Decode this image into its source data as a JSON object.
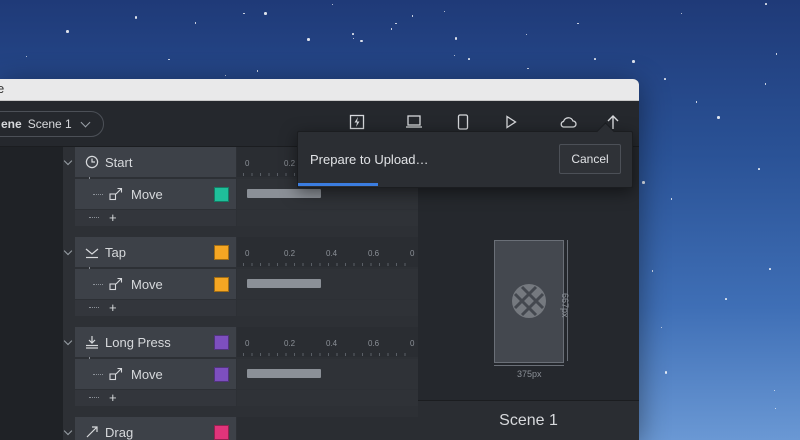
{
  "window": {
    "title_fragment": "e"
  },
  "toolbar": {
    "scene_label": "ene",
    "scene_value": "Scene 1",
    "icons": [
      "flash-icon",
      "laptop-icon",
      "phone-icon",
      "play-icon",
      "cloud-icon",
      "upload-arrow-icon"
    ]
  },
  "groups": [
    {
      "trigger": "Start",
      "trigger_icon": "clock-icon",
      "action": "Move",
      "action_icon": "move-arrow-icon",
      "color": "#1fbf9a",
      "add_label": "+"
    },
    {
      "trigger": "Tap",
      "trigger_icon": "tap-icon",
      "trigger_color": "#f5a623",
      "action": "Move",
      "action_icon": "move-arrow-icon",
      "color": "#f5a623",
      "add_label": "+"
    },
    {
      "trigger": "Long Press",
      "trigger_icon": "long-press-icon",
      "trigger_color": "#7d4fbf",
      "action": "Move",
      "action_icon": "move-arrow-icon",
      "color": "#7d4fbf",
      "add_label": "+"
    },
    {
      "trigger": "Drag",
      "trigger_icon": "drag-icon",
      "trigger_color": "#e0347a"
    }
  ],
  "ruler": {
    "ticks": [
      "0",
      "0.2",
      "0.4",
      "0.6",
      "0"
    ],
    "first_ticks": [
      "0",
      "0.2"
    ]
  },
  "preview": {
    "width_label": "375px",
    "height_label": "667px",
    "scene_name": "Scene 1"
  },
  "upload_popup": {
    "message": "Prepare to Upload…",
    "cancel_label": "Cancel",
    "progress": 0.24
  }
}
